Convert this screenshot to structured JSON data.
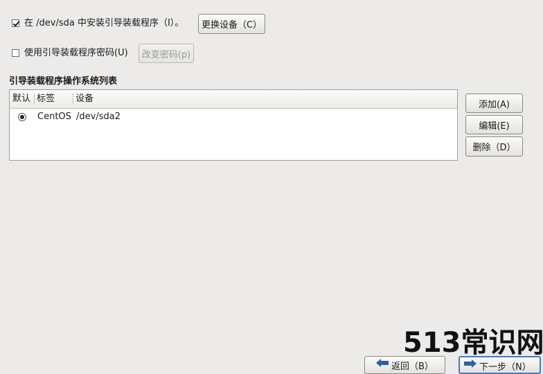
{
  "options": {
    "install_bootloader": {
      "label": "在 /dev/sda 中安装引导装载程序（I）。",
      "checked": true
    },
    "change_device_button": "更换设备（C）",
    "use_password": {
      "label": "使用引导装载程序密码(U)",
      "checked": false
    },
    "change_password_button": "改变密码(p)"
  },
  "os_list": {
    "title": "引导装载程序操作系统列表",
    "columns": [
      "默认",
      "标签",
      "设备"
    ],
    "rows": [
      {
        "default": true,
        "label": "CentOS",
        "device": "/dev/sda2"
      }
    ]
  },
  "actions": {
    "add": "添加(A)",
    "edit": "编辑(E)",
    "delete": "删除（D）"
  },
  "navigation": {
    "back": "返回（B）",
    "next": "下一步（N）"
  },
  "watermark": "513常识网",
  "colors": {
    "background": "#edebe9",
    "focus_border": "#4a78b8",
    "arrow_blue": "#2f5fa8"
  }
}
